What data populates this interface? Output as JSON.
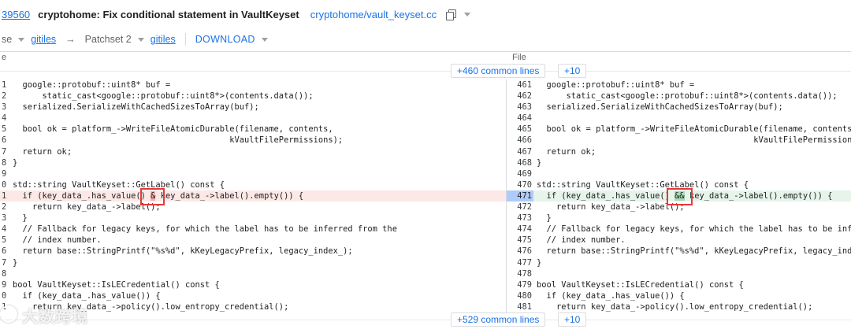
{
  "header": {
    "change_number": "39560",
    "subject": "cryptohome: Fix conditional statement in VaultKeyset",
    "file_path": "cryptohome/vault_keyset.cc"
  },
  "patch_bar": {
    "base_label": "se",
    "base_link": "gitiles",
    "arrow": "→",
    "patchset_label": "Patchset 2",
    "patchset_link": "gitiles",
    "download_label": "DOWNLOAD"
  },
  "file_row": {
    "left_label": "e",
    "file_label": "File"
  },
  "common_lines": {
    "top_label": "+460 common lines",
    "top_more": "+10",
    "bottom_label": "+529 common lines",
    "bottom_more": "+10"
  },
  "left_lines": [
    {
      "num": "1",
      "code": "  google::protobuf::uint8* buf =",
      "type": "normal"
    },
    {
      "num": "2",
      "code": "      static_cast<google::protobuf::uint8*>(contents.data());",
      "type": "normal"
    },
    {
      "num": "3",
      "code": "  serialized.SerializeWithCachedSizesToArray(buf);",
      "type": "normal"
    },
    {
      "num": "4",
      "code": "",
      "type": "normal"
    },
    {
      "num": "5",
      "code": "  bool ok = platform_->WriteFileAtomicDurable(filename, contents,",
      "type": "normal"
    },
    {
      "num": "6",
      "code": "                                            kVaultFilePermissions);",
      "type": "normal"
    },
    {
      "num": "7",
      "code": "  return ok;",
      "type": "normal"
    },
    {
      "num": "8",
      "code": "}",
      "type": "normal"
    },
    {
      "num": "9",
      "code": "",
      "type": "normal"
    },
    {
      "num": "0",
      "code": "std::string VaultKeyset::GetLabel() const {",
      "type": "normal"
    },
    {
      "num": "1",
      "code_pre": "  if (key_data_.has_value() ",
      "code_hl": "&",
      "code_post": " key_data_->label().empty()) {",
      "type": "removed"
    },
    {
      "num": "2",
      "code": "    return key_data_->label();",
      "type": "normal"
    },
    {
      "num": "3",
      "code": "  }",
      "type": "normal"
    },
    {
      "num": "4",
      "code": "  // Fallback for legacy keys, for which the label has to be inferred from the",
      "type": "normal"
    },
    {
      "num": "5",
      "code": "  // index number.",
      "type": "normal"
    },
    {
      "num": "6",
      "code": "  return base::StringPrintf(\"%s%d\", kKeyLegacyPrefix, legacy_index_);",
      "type": "normal"
    },
    {
      "num": "7",
      "code": "}",
      "type": "normal"
    },
    {
      "num": "8",
      "code": "",
      "type": "normal"
    },
    {
      "num": "9",
      "code": "bool VaultKeyset::IsLECredential() const {",
      "type": "normal"
    },
    {
      "num": "0",
      "code": "  if (key_data_.has_value()) {",
      "type": "normal"
    },
    {
      "num": "1",
      "code": "    return key_data_->policy().low_entropy_credential();",
      "type": "normal"
    }
  ],
  "right_lines": [
    {
      "num": "461",
      "code": "  google::protobuf::uint8* buf =",
      "type": "normal"
    },
    {
      "num": "462",
      "code": "      static_cast<google::protobuf::uint8*>(contents.data());",
      "type": "normal"
    },
    {
      "num": "463",
      "code": "  serialized.SerializeWithCachedSizesToArray(buf);",
      "type": "normal"
    },
    {
      "num": "464",
      "code": "",
      "type": "normal"
    },
    {
      "num": "465",
      "code": "  bool ok = platform_->WriteFileAtomicDurable(filename, contents,",
      "type": "normal"
    },
    {
      "num": "466",
      "code": "                                            kVaultFilePermissions);",
      "type": "normal"
    },
    {
      "num": "467",
      "code": "  return ok;",
      "type": "normal"
    },
    {
      "num": "468",
      "code": "}",
      "type": "normal"
    },
    {
      "num": "469",
      "code": "",
      "type": "normal"
    },
    {
      "num": "470",
      "code": "std::string VaultKeyset::GetLabel() const {",
      "type": "normal"
    },
    {
      "num": "471",
      "code_pre": "  if (key_data_.has_value() ",
      "code_hl": "&&",
      "code_post": " key_data_->label().empty()) {",
      "type": "added"
    },
    {
      "num": "472",
      "code": "    return key_data_->label();",
      "type": "normal"
    },
    {
      "num": "473",
      "code": "  }",
      "type": "normal"
    },
    {
      "num": "474",
      "code": "  // Fallback for legacy keys, for which the label has to be inferred from the",
      "type": "normal"
    },
    {
      "num": "475",
      "code": "  // index number.",
      "type": "normal"
    },
    {
      "num": "476",
      "code": "  return base::StringPrintf(\"%s%d\", kKeyLegacyPrefix, legacy_index_);",
      "type": "normal"
    },
    {
      "num": "477",
      "code": "}",
      "type": "normal"
    },
    {
      "num": "478",
      "code": "",
      "type": "normal"
    },
    {
      "num": "479",
      "code": "bool VaultKeyset::IsLECredential() const {",
      "type": "normal"
    },
    {
      "num": "480",
      "code": "  if (key_data_.has_value()) {",
      "type": "normal"
    },
    {
      "num": "481",
      "code": "    return key_data_->policy().low_entropy_credential();",
      "type": "normal"
    }
  ],
  "watermark": "大数跨境",
  "colors": {
    "removed_bg": "#fce8e6",
    "added_bg": "#e6f4ea",
    "link": "#1a73e8",
    "highlight_box": "#e53935"
  }
}
